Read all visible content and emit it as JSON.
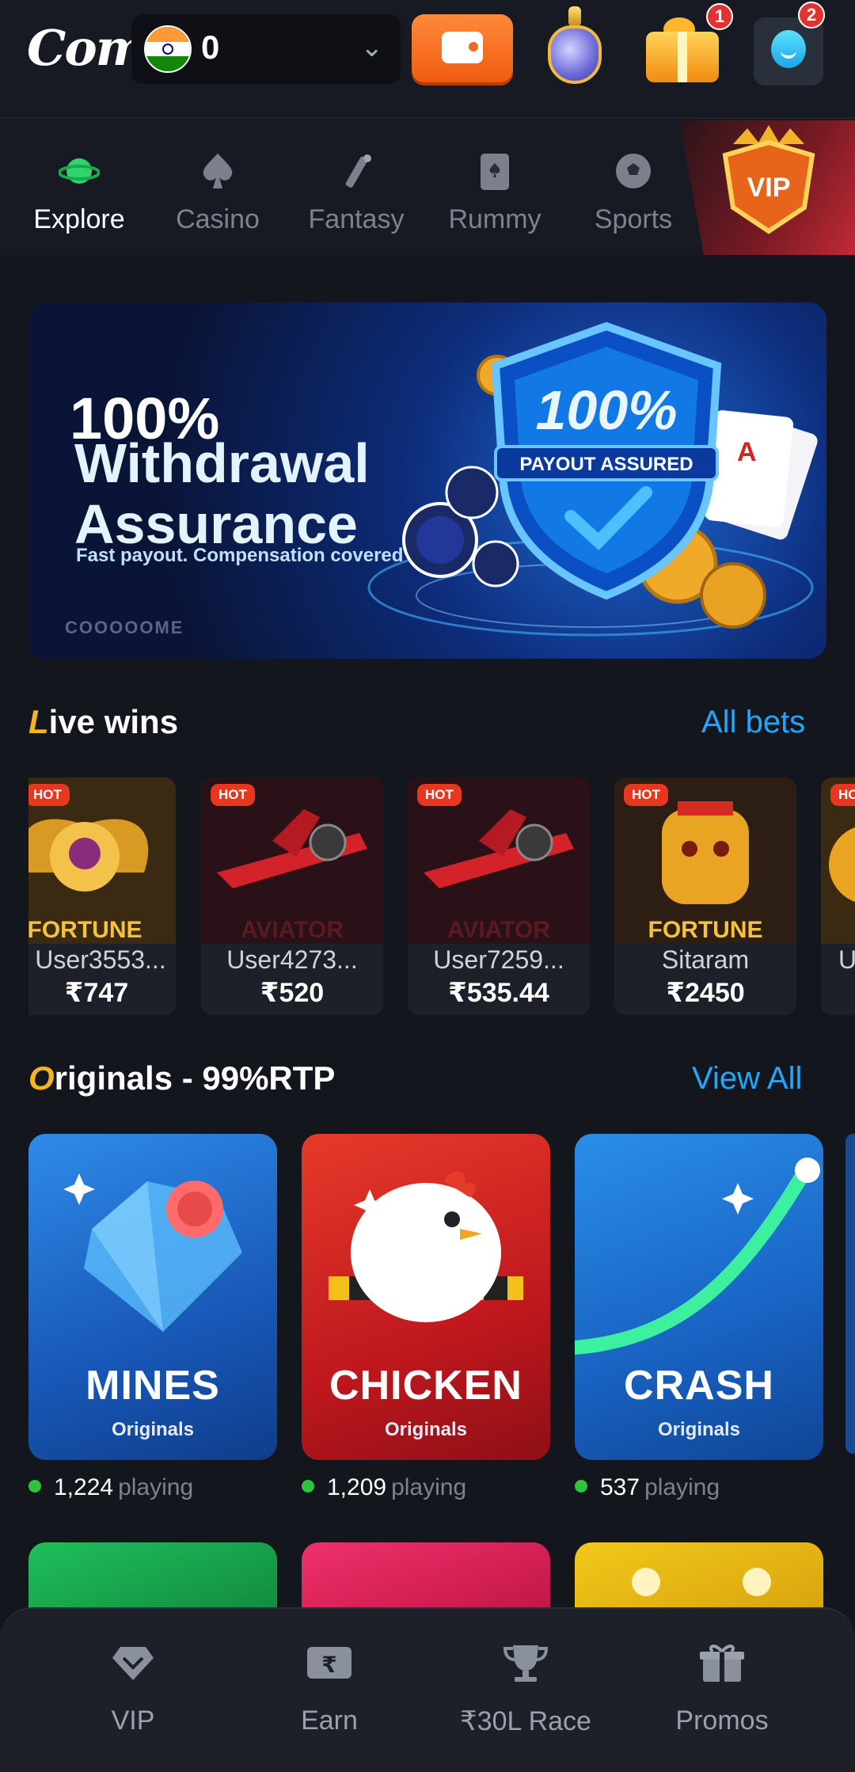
{
  "header": {
    "logo_text": "Come",
    "balance": "0",
    "notifications": {
      "treasure_badge": "1",
      "support_badge": "2"
    }
  },
  "category_tabs": [
    {
      "label": "Explore",
      "icon": "planet-icon",
      "active": true
    },
    {
      "label": "Casino",
      "icon": "spade-icon",
      "active": false
    },
    {
      "label": "Fantasy",
      "icon": "cricket-bat-icon",
      "active": false
    },
    {
      "label": "Rummy",
      "icon": "card-icon",
      "active": false
    },
    {
      "label": "Sports",
      "icon": "football-icon",
      "active": false
    }
  ],
  "vip_tab": {
    "label": "VIP"
  },
  "banner": {
    "line1": "100%",
    "line2": "Withdrawal",
    "line3": "Assurance",
    "subtitle": "Fast payout. Compensation covered",
    "shield_text": "100%",
    "shield_ribbon": "PAYOUT ASSURED",
    "brand": "COOOOOME"
  },
  "live_wins": {
    "title_first": "L",
    "title_rest": "ive wins",
    "link": "All bets",
    "cards": [
      {
        "tag": "HOT",
        "user": "User3553...",
        "amount": "₹747",
        "game_text": "FORTUNE"
      },
      {
        "tag": "HOT",
        "user": "User4273...",
        "amount": "₹520",
        "game_text": "AVIATOR"
      },
      {
        "tag": "HOT",
        "user": "User7259...",
        "amount": "₹535.44",
        "game_text": "AVIATOR"
      },
      {
        "tag": "HOT",
        "user": "Sitaram",
        "amount": "₹2450",
        "game_text": "FORTUNE"
      },
      {
        "tag": "HO",
        "user": "U",
        "amount": "",
        "game_text": ""
      }
    ]
  },
  "originals": {
    "title_first": "O",
    "title_rest": "riginals - 99%RTP",
    "link": "View All",
    "games": [
      {
        "title": "MINES",
        "sub": "Originals",
        "playing_count": "1,224",
        "playing_label": "playing"
      },
      {
        "title": "CHICKEN",
        "sub": "Originals",
        "playing_count": "1,209",
        "playing_label": "playing"
      },
      {
        "title": "CRASH",
        "sub": "Originals",
        "playing_count": "537",
        "playing_label": "playing"
      }
    ]
  },
  "bottom_nav": [
    {
      "label": "VIP",
      "icon": "diamond-icon"
    },
    {
      "label": "Earn",
      "icon": "rupee-card-icon"
    },
    {
      "label": "₹30L Race",
      "icon": "trophy-icon"
    },
    {
      "label": "Promos",
      "icon": "gift-icon"
    }
  ],
  "colors": {
    "background": "#14161d",
    "accent_orange": "#f05a12",
    "link_blue": "#1fa8ff",
    "title_gold": "#f6b51b",
    "online_green": "#2ec43e"
  }
}
